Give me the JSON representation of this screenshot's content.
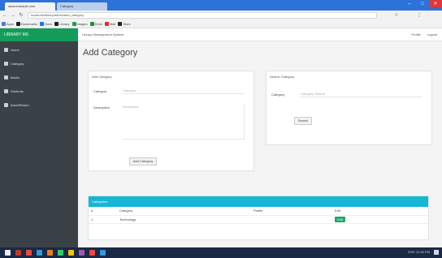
{
  "browser": {
    "tabs": [
      {
        "label": "www.example.com"
      },
      {
        "label": "Category"
      }
    ],
    "url": "localhost/library/admin/add_category",
    "bookmarks": [
      "Apps",
      "Bookmarks",
      "Docs",
      "Library",
      "Images",
      "Drive",
      "Mail",
      "Store"
    ]
  },
  "app": {
    "brand": "LIBRARY MS",
    "breadcrumb": "Library Management System",
    "top_links": [
      "Profile",
      "Logout"
    ],
    "sidebar": [
      {
        "label": "Home"
      },
      {
        "label": "Category"
      },
      {
        "label": "Books"
      },
      {
        "label": "Students"
      },
      {
        "label": "Issue/Return"
      }
    ]
  },
  "page": {
    "title": "Add Category"
  },
  "add_form": {
    "panel_title": "Add Category",
    "category_label": "Category",
    "category_placeholder": "Category",
    "description_label": "Description",
    "description_placeholder": "Description",
    "submit_label": "Add Category"
  },
  "search_form": {
    "panel_title": "Search Category",
    "category_label": "Category",
    "category_placeholder": "Category Search",
    "submit_label": "Search"
  },
  "list": {
    "title": "Categories",
    "columns": [
      "#",
      "Category",
      "Profile",
      "Edit"
    ],
    "rows": [
      {
        "id": "1",
        "category": "Technology",
        "profile": "",
        "edit": "Edit"
      }
    ]
  },
  "taskbar": {
    "tray_text": "ENG 12:30 PM"
  },
  "colors": {
    "brand_green": "#149c5a",
    "sidebar": "#3a4147",
    "list_header": "#16b6d5",
    "edit_button": "#1ba76f",
    "taskbar": "#1a2944"
  }
}
